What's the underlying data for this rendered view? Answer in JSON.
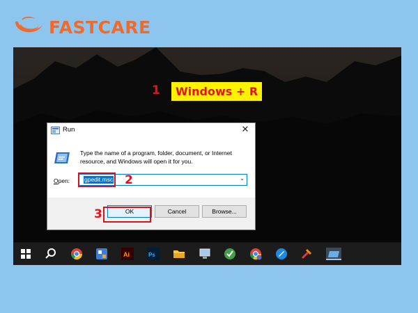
{
  "brand": {
    "name": "FASTCARE"
  },
  "steps": {
    "step1_number": "1",
    "step1_hotkey": "Windows + R",
    "step2_number": "2",
    "step3_number": "3"
  },
  "dialog": {
    "title": "Run",
    "close_glyph": "✕",
    "description": "Type the name of a program, folder, document, or Internet resource, and Windows will open it for you.",
    "open_label_prefix": "O",
    "open_label_rest": "pen:",
    "open_value": "gpedit.msc",
    "ok_label": "OK",
    "cancel_label": "Cancel",
    "browse_label": "Browse..."
  },
  "taskbar": {
    "icons": [
      "windows-start-icon",
      "search-icon",
      "chrome-icon",
      "settings-app-icon",
      "illustrator-icon",
      "photoshop-icon",
      "file-explorer-icon",
      "network-computer-icon",
      "green-app-icon",
      "chrome-profile-icon",
      "blue-app-icon",
      "red-tools-icon",
      "active-window-icon"
    ]
  },
  "colors": {
    "background": "#8ec5ee",
    "brand_orange": "#f06a2a",
    "highlight_red": "#d0161b",
    "hotkey_yellow": "#fff200",
    "accent_blue": "#0078d7"
  }
}
